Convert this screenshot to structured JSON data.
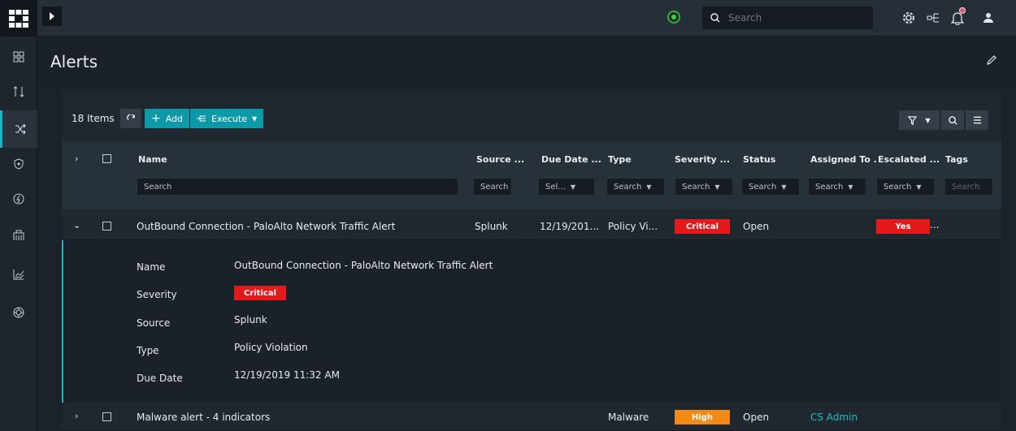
{
  "nav": {
    "items": [
      {
        "icon": "dashboard-icon"
      },
      {
        "icon": "queue-icon"
      },
      {
        "icon": "shuffle-icon"
      },
      {
        "icon": "shield-icon"
      },
      {
        "icon": "bolt-icon"
      },
      {
        "icon": "building-icon"
      },
      {
        "icon": "chart-icon"
      },
      {
        "icon": "globe-icon"
      }
    ]
  },
  "topbar": {
    "search_placeholder": "Search"
  },
  "page": {
    "title": "Alerts"
  },
  "toolbar": {
    "items_count": "18 Items",
    "add_label": "Add",
    "execute_label": "Execute"
  },
  "table": {
    "columns": [
      "Name",
      "Source ...",
      "Due Date ...",
      "Type",
      "Severity ...",
      "Status",
      "Assigned To .",
      "Escalated ...",
      "Tags"
    ],
    "filters": {
      "name": "Search",
      "source": "Search",
      "due_date": "Sel...",
      "type": "Search",
      "severity": "Search",
      "status": "Search",
      "assigned": "Search",
      "escalated": "Search",
      "tags": "Search"
    },
    "rows": [
      {
        "name": "OutBound Connection - PaloAlto Network Traffic Alert",
        "source": "Splunk",
        "due_date": "12/19/201...",
        "type": "Policy Vi...",
        "severity": "Critical",
        "status": "Open",
        "assigned": "",
        "escalated": "Yes",
        "escalated_more": "...",
        "expanded": true
      },
      {
        "name": "Malware alert - 4 indicators",
        "source": "",
        "due_date": "",
        "type": "Malware",
        "severity": "High",
        "status": "Open",
        "assigned": "CS Admin",
        "escalated": "",
        "expanded": false
      }
    ],
    "detail": {
      "labels": {
        "name": "Name",
        "severity": "Severity",
        "source": "Source",
        "type": "Type",
        "due_date": "Due Date"
      },
      "values": {
        "name": "OutBound Connection - PaloAlto Network Traffic Alert",
        "severity": "Critical",
        "source": "Splunk",
        "type": "Policy Violation",
        "due_date": "12/19/2019 11:32 AM"
      }
    }
  },
  "colors": {
    "accent": "#0c9aa9",
    "critical": "#e3191b",
    "high": "#f28a13",
    "link": "#24bdc9"
  }
}
